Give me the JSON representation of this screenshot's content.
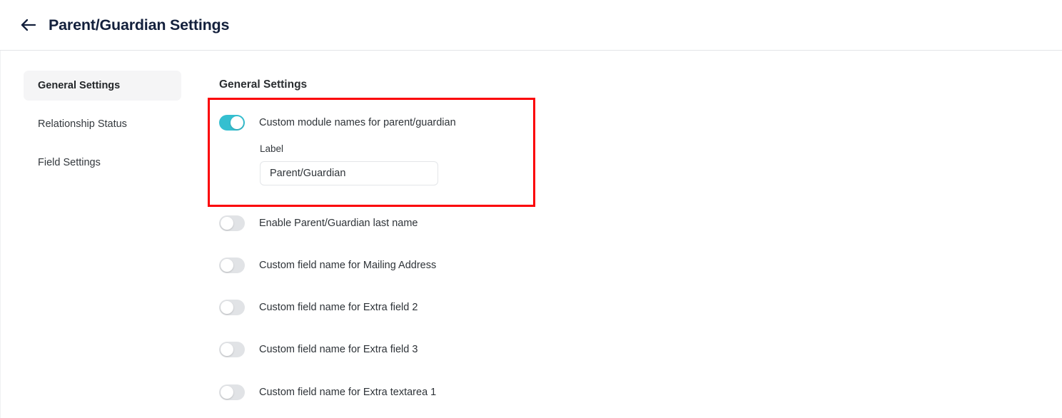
{
  "header": {
    "back_icon": "arrow-left-icon",
    "title": "Parent/Guardian Settings"
  },
  "sidebar": {
    "items": [
      {
        "label": "General Settings",
        "active": true
      },
      {
        "label": "Relationship Status",
        "active": false
      },
      {
        "label": "Field Settings",
        "active": false
      }
    ]
  },
  "main": {
    "section_heading": "General Settings",
    "rows": [
      {
        "label": "Custom module names for parent/guardian",
        "enabled": true
      },
      {
        "label": "Enable Parent/Guardian last name",
        "enabled": false
      },
      {
        "label": "Custom field name for Mailing Address",
        "enabled": false
      },
      {
        "label": "Custom field name for Extra field 2",
        "enabled": false
      },
      {
        "label": "Custom field name for Extra field 3",
        "enabled": false
      },
      {
        "label": "Custom field name for Extra textarea 1",
        "enabled": false
      }
    ],
    "field": {
      "label": "Label",
      "value": "Parent/Guardian",
      "placeholder": "Parent/Guardian"
    }
  },
  "colors": {
    "toggle_on": "#35bfd0",
    "toggle_off": "#e1e3e6",
    "highlight_border": "#fb0006",
    "title": "#13203c",
    "sidebar_active_bg": "#f5f5f6"
  }
}
